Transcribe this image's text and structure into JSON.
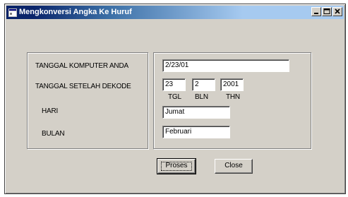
{
  "window": {
    "title": "Mengkonversi Angka Ke Huruf"
  },
  "labels": {
    "tanggal_komputer": "TANGGAL  KOMPUTER ANDA",
    "tanggal_setelah": "TANGGAL SETELAH DEKODE",
    "hari": "HARI",
    "bulan": "BULAN",
    "tgl": "TGL",
    "bln": "BLN",
    "thn": "THN"
  },
  "fields": {
    "computer_date": "2/23/01",
    "tgl": "23",
    "bln": "2",
    "thn": "2001",
    "hari": "Jumat",
    "bulan": "Februari"
  },
  "buttons": {
    "proses": "Proses",
    "close": "Close"
  }
}
